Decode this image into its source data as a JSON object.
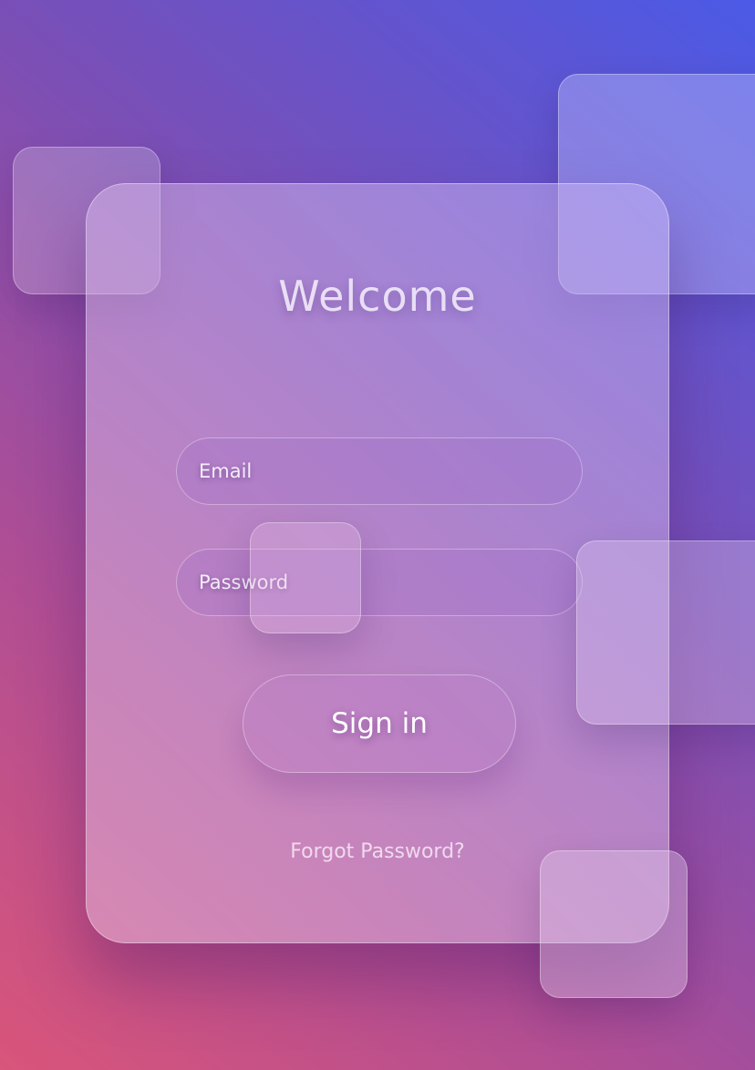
{
  "login": {
    "title": "Welcome",
    "email_placeholder": "Email",
    "password_placeholder": "Password",
    "submit_label": "Sign in",
    "forgot_label": "Forgot Password?"
  },
  "colors": {
    "background_start": "#d9557a",
    "background_end": "#4b5ae6"
  }
}
